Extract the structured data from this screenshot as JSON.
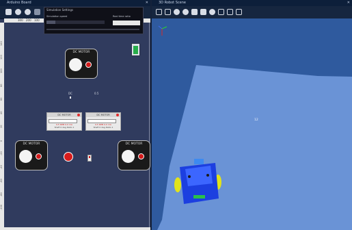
{
  "left_window": {
    "title": "Arduino Board",
    "ruler_top": [
      "300",
      "200",
      "100"
    ],
    "ruler_left": [
      "140",
      "120",
      "100",
      "80",
      "60",
      "40",
      "20",
      "0",
      "-20",
      "-40",
      "-60",
      "-80",
      "-100"
    ],
    "motor_top_label": "DC MOTOR",
    "motor_left_label": "DC MOTOR",
    "motor_right_label": "DC MOTOR",
    "text_a": "DC",
    "text_b": "0.5",
    "panel_left_title": "DC MOTOR",
    "panel_left_line1": "0.5 RPM 0.0 mA",
    "panel_left_line2": "Shaft 0 deg  Ratio 1",
    "panel_right_title": "DC MOTOR",
    "panel_right_line1": "0.5 RPM 0.0 mA",
    "panel_right_line2": "Shaft 0 deg  Ratio 1"
  },
  "dialog": {
    "title": "Simulation Settings",
    "label_left": "Simulation speed",
    "label_right": "Real time ratio",
    "speed_value": 0.15
  },
  "right_window": {
    "title": "3D Robot Scene",
    "floor_label": "12"
  },
  "colors": {
    "left_bg": "#303b5e",
    "right_bg": "#2f5a9e",
    "robot_body": "#1c3fe0",
    "robot_wheels": "#e2e31a",
    "motor_red": "#d21919",
    "led_green": "#27ad4a"
  }
}
